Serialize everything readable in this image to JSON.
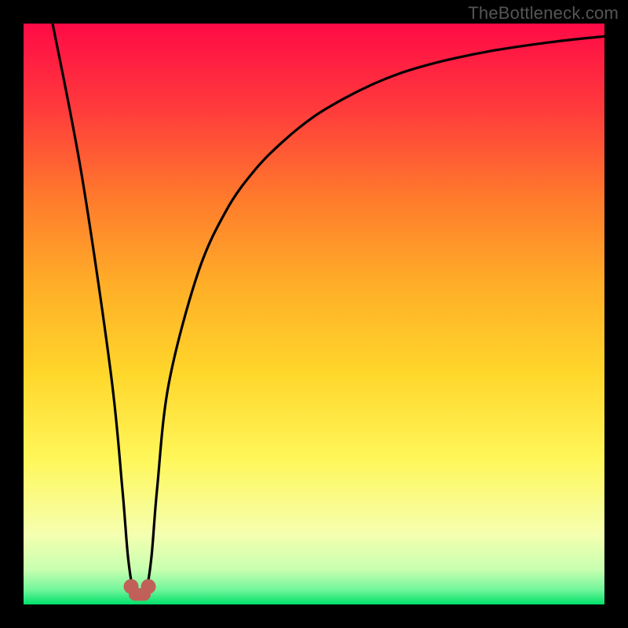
{
  "watermark": "TheBottleneck.com",
  "chart_data": {
    "type": "line",
    "title": "",
    "xlabel": "",
    "ylabel": "",
    "xlim": [
      0,
      100
    ],
    "ylim": [
      0,
      100
    ],
    "series": [
      {
        "name": "curve",
        "x": [
          5,
          10,
          15,
          17,
          18,
          19,
          20,
          21,
          22,
          23,
          25,
          30,
          35,
          40,
          45,
          50,
          55,
          60,
          65,
          70,
          75,
          80,
          85,
          90,
          95,
          100
        ],
        "y": [
          100,
          74,
          40,
          20,
          8,
          2,
          2,
          2,
          8,
          20,
          38,
          57,
          68,
          75,
          80,
          84,
          87,
          89.5,
          91.5,
          93,
          94.2,
          95.2,
          96,
          96.7,
          97.3,
          97.8
        ]
      }
    ],
    "valley": {
      "x": 20,
      "y": 2
    },
    "background_gradient": {
      "stops": [
        {
          "pos": 0.0,
          "color": "#ff0a46"
        },
        {
          "pos": 0.15,
          "color": "#ff3c3c"
        },
        {
          "pos": 0.3,
          "color": "#ff7a2c"
        },
        {
          "pos": 0.45,
          "color": "#ffae28"
        },
        {
          "pos": 0.6,
          "color": "#ffd62a"
        },
        {
          "pos": 0.75,
          "color": "#fff75a"
        },
        {
          "pos": 0.88,
          "color": "#f5ffb0"
        },
        {
          "pos": 0.94,
          "color": "#c8ffb0"
        },
        {
          "pos": 0.975,
          "color": "#70f59a"
        },
        {
          "pos": 1.0,
          "color": "#00e06a"
        }
      ]
    },
    "valley_marker": {
      "color": "#c06058",
      "radius_px": 10
    }
  }
}
